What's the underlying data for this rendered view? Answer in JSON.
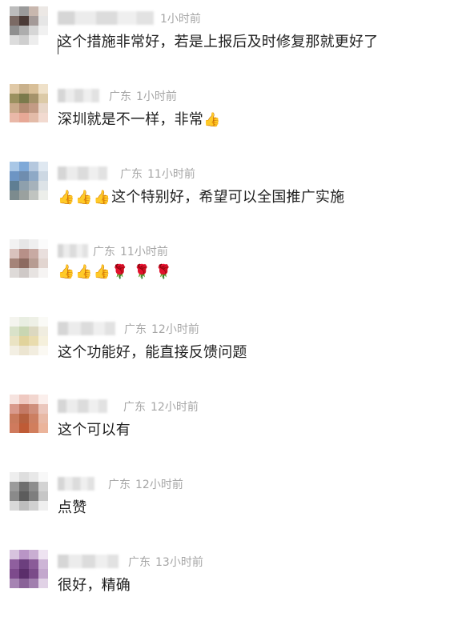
{
  "comments": [
    {
      "location": "",
      "time": "1小时前",
      "text": "这个措施非常好，若是上报后及时修复那就更好了",
      "emoji": [],
      "avatar": [
        "#bcbcbc",
        "#9a9a9a",
        "#c8b7ae",
        "#ece8e5",
        "#7b6a64",
        "#4b3b37",
        "#a49a98",
        "#e6e6e6",
        "#8f8f8f",
        "#adadad",
        "#d6d6d6",
        "#f1f1f1",
        "#dcdcdc",
        "#cfcfcf",
        "#ededed",
        "#ffffff"
      ]
    },
    {
      "location": "广东",
      "time": "1小时前",
      "text": "深圳就是不一样，非常",
      "emoji": [
        "👍"
      ],
      "avatar": [
        "#e0c9a7",
        "#c9b18c",
        "#d8bf98",
        "#efe1c9",
        "#9b9160",
        "#7b7a4c",
        "#a5936b",
        "#dccaa7",
        "#c8a98a",
        "#b48c73",
        "#c39b85",
        "#e8d6c8",
        "#e9b8a8",
        "#e7a896",
        "#e3bba8",
        "#f2dad0"
      ]
    },
    {
      "location": "广东",
      "time": "11小时前",
      "text": "这个特别好，希望可以全国推广实施",
      "emoji": [
        "👍",
        "👍",
        "👍"
      ],
      "avatar": [
        "#a9c7e6",
        "#7fa9d8",
        "#b5c8de",
        "#dfe8f1",
        "#6d95c4",
        "#6f8daf",
        "#8ea9c6",
        "#cdd8e3",
        "#5f7e93",
        "#8ea0ad",
        "#a6b2bb",
        "#dde3e7",
        "#7c8b8e",
        "#9aa19f",
        "#c0c4c0",
        "#eceeea"
      ]
    },
    {
      "location": "广东",
      "time": "11小时前",
      "text": "",
      "emoji": [
        "👍",
        "👍",
        "👍",
        "🌹",
        "🌹",
        "🌹"
      ],
      "avatar": [
        "#f2f2f2",
        "#e6e6e6",
        "#efefef",
        "#fbfbfb",
        "#d9c2bd",
        "#b79088",
        "#c8aaa3",
        "#e9dfdd",
        "#a58479",
        "#8c6a60",
        "#b79c92",
        "#e2d5d0",
        "#dedad8",
        "#cfc9c7",
        "#e7e3e1",
        "#f6f4f3"
      ]
    },
    {
      "location": "广东",
      "time": "12小时前",
      "text": "这个功能好，能直接反馈问题",
      "emoji": [],
      "avatar": [
        "#f4f4ee",
        "#e9eee2",
        "#eef0e6",
        "#fafaf6",
        "#d9e2c9",
        "#c9d6b2",
        "#dcd8c0",
        "#f0ede0",
        "#eae3c3",
        "#e1d39c",
        "#e9dcae",
        "#f5f0dc",
        "#f3efe3",
        "#ece5d1",
        "#f2eddf",
        "#fbf9f3"
      ]
    },
    {
      "location": "广东",
      "time": "12小时前",
      "text": "这个可以有",
      "emoji": [],
      "avatar": [
        "#f6e3df",
        "#efc9c1",
        "#f2d6cf",
        "#fbefec",
        "#d99a8c",
        "#c47a66",
        "#cf8f7c",
        "#ebc7bd",
        "#c97a5c",
        "#b5603f",
        "#cc7f62",
        "#e8b9a6",
        "#cf7a5d",
        "#bf5b36",
        "#d17e5d",
        "#ebb49b"
      ]
    },
    {
      "location": "广东",
      "time": "12小时前",
      "text": "点赞",
      "emoji": [],
      "avatar": [
        "#eeeeee",
        "#dedede",
        "#e8e8e8",
        "#f8f8f8",
        "#9b9b9b",
        "#6f6f6f",
        "#8d8d8d",
        "#d3d3d3",
        "#8a8a8a",
        "#5c5c5c",
        "#7e7e7e",
        "#c6c6c6",
        "#d9d9d9",
        "#bdbdbd",
        "#d0d0d0",
        "#efefef"
      ]
    },
    {
      "location": "广东",
      "time": "13小时前",
      "text": "很好，精确",
      "emoji": [],
      "avatar": [
        "#d7c3de",
        "#b995c6",
        "#c9aed2",
        "#eee3f1",
        "#8f5f9e",
        "#6c3f7e",
        "#8a5b98",
        "#cdb5d6",
        "#7d4a8c",
        "#5b2e6b",
        "#7a4b89",
        "#c3a7cd",
        "#a684b3",
        "#8a6398",
        "#a17fae",
        "#e1d2e6"
      ]
    }
  ]
}
